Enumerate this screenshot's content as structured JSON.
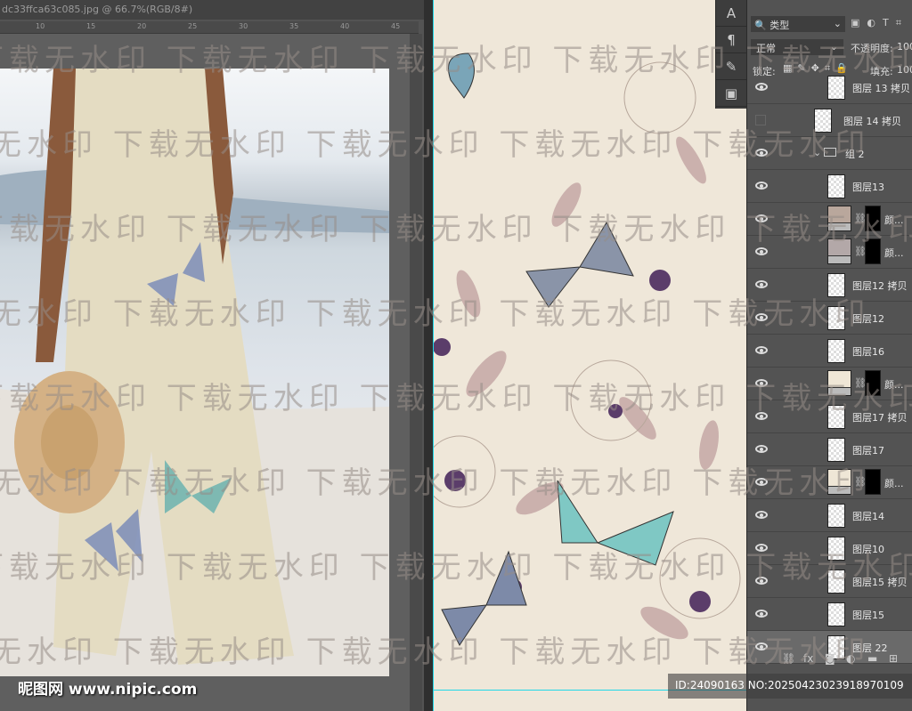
{
  "document": {
    "tab_title": "dc33ffca63c085.jpg @ 66.7%(RGB/8#)",
    "ruler_ticks": [
      "10",
      "15",
      "20",
      "25",
      "30",
      "35",
      "40",
      "45"
    ]
  },
  "tools": [
    {
      "icon": "character-icon",
      "glyph": "A"
    },
    {
      "icon": "paragraph-icon",
      "glyph": "¶"
    },
    {
      "icon": "brush-settings-icon",
      "glyph": "✎"
    },
    {
      "icon": "layer-comps-icon",
      "glyph": "▣"
    }
  ],
  "layers_panel": {
    "filter_label": "类型",
    "filter_icons": [
      "image-filter-icon",
      "adjustment-filter-icon",
      "type-filter-icon",
      "shape-filter-icon"
    ],
    "blend_mode": "正常",
    "opacity_label": "不透明度:",
    "opacity_value": "100",
    "lock_label": "锁定:",
    "fill_label": "填充:",
    "fill_value": "100",
    "layers": [
      {
        "name": "图层 13 拷贝",
        "visible": true,
        "type": "pixel",
        "indent": 2
      },
      {
        "name": "图层 14 拷贝",
        "visible": false,
        "type": "pixel",
        "indent": 1
      },
      {
        "name": "组 2",
        "visible": true,
        "type": "group",
        "indent": 1
      },
      {
        "name": "图层13",
        "visible": true,
        "type": "pixel",
        "indent": 2
      },
      {
        "name": "颜...",
        "visible": true,
        "type": "adjust",
        "color": "#b9a79c",
        "indent": 2
      },
      {
        "name": "颜...",
        "visible": true,
        "type": "adjust",
        "color": "#b3a8a8",
        "indent": 2
      },
      {
        "name": "图层12 拷贝",
        "visible": true,
        "type": "pixel",
        "indent": 2
      },
      {
        "name": "图层12",
        "visible": true,
        "type": "pixel",
        "indent": 2
      },
      {
        "name": "图层16",
        "visible": true,
        "type": "pixel",
        "indent": 2
      },
      {
        "name": "颜...",
        "visible": true,
        "type": "adjust",
        "color": "#efe6d6",
        "indent": 2
      },
      {
        "name": "图层17 拷贝",
        "visible": true,
        "type": "pixel",
        "indent": 2
      },
      {
        "name": "图层17",
        "visible": true,
        "type": "pixel",
        "indent": 2
      },
      {
        "name": "颜...",
        "visible": true,
        "type": "adjust",
        "color": "#efe6d6",
        "indent": 2
      },
      {
        "name": "图层14",
        "visible": true,
        "type": "pixel",
        "indent": 2
      },
      {
        "name": "图层10",
        "visible": true,
        "type": "pixel",
        "indent": 2
      },
      {
        "name": "图层15 拷贝",
        "visible": true,
        "type": "pixel",
        "indent": 2
      },
      {
        "name": "图层15",
        "visible": true,
        "type": "pixel",
        "indent": 2
      },
      {
        "name": "图层 22",
        "visible": true,
        "type": "pixel",
        "indent": 2,
        "selected": true
      }
    ],
    "bottom_icons": [
      {
        "name": "link-icon",
        "glyph": "⛓"
      },
      {
        "name": "fx-icon",
        "glyph": "fx"
      },
      {
        "name": "mask-icon",
        "glyph": "◙"
      },
      {
        "name": "adjustment-icon",
        "glyph": "◐"
      },
      {
        "name": "folder-icon",
        "glyph": "▬"
      },
      {
        "name": "new-layer-icon",
        "glyph": "⊞"
      }
    ]
  },
  "watermark": {
    "text": "下载无水印",
    "site_logo": "昵图网 www.nipic.com",
    "id_text": "ID:24090163 NO:20250423023918970109"
  }
}
